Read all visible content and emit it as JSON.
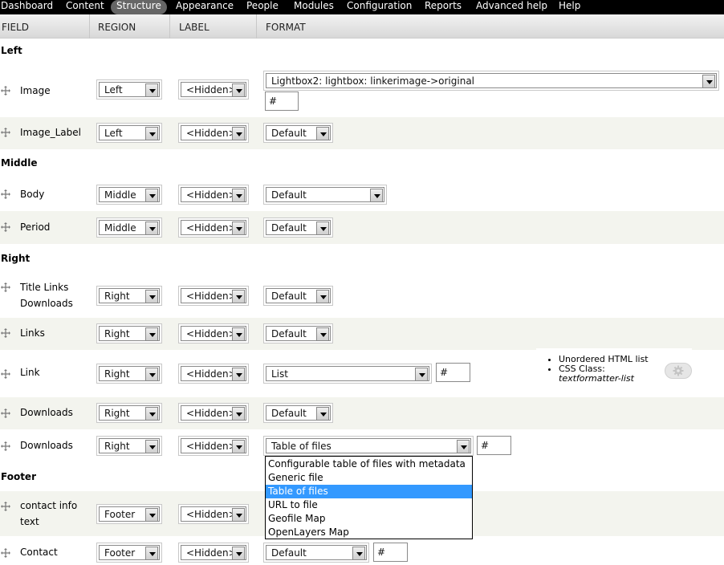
{
  "nav": [
    {
      "label": "Dashboard",
      "active": false
    },
    {
      "label": "Content",
      "active": false
    },
    {
      "label": "Structure",
      "active": true
    },
    {
      "label": "Appearance",
      "active": false
    },
    {
      "label": "People",
      "active": false
    },
    {
      "label": "Modules",
      "active": false
    },
    {
      "label": "Configuration",
      "active": false
    },
    {
      "label": "Reports",
      "active": false
    },
    {
      "label": "Advanced help",
      "active": false
    },
    {
      "label": "Help",
      "active": false
    }
  ],
  "table_headers": {
    "field": "FIELD",
    "region": "REGION",
    "label": "LABEL",
    "format": "FORMAT"
  },
  "regions": {
    "left": "Left",
    "middle": "Middle",
    "right": "Right",
    "footer": "Footer"
  },
  "rows": [
    {
      "field": "Image",
      "region": "Left",
      "label": "<Hidden>",
      "format": "Lightbox2: lightbox: linkerimage->original",
      "extra": "#"
    },
    {
      "field": "Image_Label",
      "region": "Left",
      "label": "<Hidden>",
      "format": "Default"
    },
    {
      "field": "Body",
      "region": "Middle",
      "label": "<Hidden>",
      "format": "Default"
    },
    {
      "field": "Period",
      "region": "Middle",
      "label": "<Hidden>",
      "format": "Default"
    },
    {
      "field": "Title Links Downloads",
      "region": "Right",
      "label": "<Hidden>",
      "format": "Default"
    },
    {
      "field": "Links",
      "region": "Right",
      "label": "<Hidden>",
      "format": "Default"
    },
    {
      "field": "Link",
      "region": "Right",
      "label": "<Hidden>",
      "format": "List",
      "extra": "#"
    },
    {
      "field": "Downloads",
      "region": "Right",
      "label": "<Hidden>",
      "format": "Default"
    },
    {
      "field": "Downloads",
      "region": "Right",
      "label": "<Hidden>",
      "format": "Table of files",
      "extra": "#"
    },
    {
      "field": "contact info text",
      "region": "Footer",
      "label": "<Hidden>",
      "format": ""
    },
    {
      "field": "Contact",
      "region": "Footer",
      "label": "<Hidden>",
      "format": "Default",
      "extra": "#"
    }
  ],
  "format_dropdown": {
    "options": [
      "Configurable table of files with metadata",
      "Generic file",
      "Table of files",
      "URL to file",
      "Geofile Map",
      "OpenLayers Map"
    ],
    "selected": "Table of files"
  },
  "link_summary": {
    "item1": "Unordered HTML list",
    "item2_label": "CSS Class:",
    "item2_value": "textformatter-list"
  },
  "colors": {
    "nav_bg": "#000000",
    "row_alt_bg": "#f3f4ee",
    "selected_option": "#3399ff"
  }
}
